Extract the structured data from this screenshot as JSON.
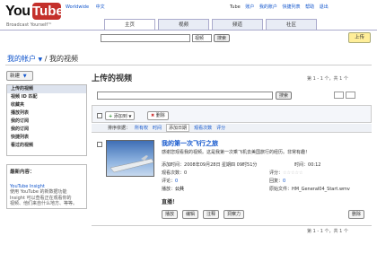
{
  "header": {
    "logo_you": "You",
    "logo_tube": "Tube",
    "tagline": "Broadcast Yourself™",
    "locale_links": [
      "Worldwide",
      "中文"
    ],
    "user_brand": "Tube",
    "user_links": [
      "账户",
      "我的账户",
      "快捷列表",
      "帮助",
      "退出"
    ],
    "tabs": [
      "主页",
      "视频",
      "频道",
      "社区"
    ],
    "search_type": "视频",
    "search_button": "搜索",
    "upload_button": "上传"
  },
  "breadcrumb": {
    "account": "我的帐户",
    "separator": "/",
    "current": "我的视频"
  },
  "sidebar": {
    "new_button": "新建",
    "items": [
      "上传的视频",
      "视频 ID 匹配",
      "收藏夹",
      "播放列表",
      "我的订阅",
      "我的订阅",
      "快捷列表",
      "看过的视频"
    ],
    "insight_title": "最新内容：",
    "insight_link": "YouTube Insight",
    "insight_desc": [
      "使用 YouTube 的新数据功能",
      "Insight 可以查看正在观看你的",
      "视频、他们来自什么地方、等等。"
    ]
  },
  "main": {
    "title": "上传的视频",
    "pager": "第 1 - 1 个，共 1 个",
    "search_button": "搜索",
    "toolbar": {
      "add_to": "添加到",
      "remove": "删除"
    },
    "sort": {
      "label": "排序依据：",
      "options": [
        "所有权",
        "时间",
        "添加日期",
        "观看次数",
        "评分"
      ],
      "selected": "添加日期"
    },
    "video": {
      "title": "我的第一次飞行之旅",
      "description": "感谢您观看我的视频。这是我第一次乘飞机去美国旅行的经历。非常有趣！",
      "added_label": "添加时间：",
      "added_value": "2008年09月28日 星期四 09时51分",
      "duration_label": "时间：",
      "duration_value": "00:12",
      "views_label": "观看次数：",
      "views_value": "0",
      "rating_label": "评分：",
      "comments_label": "评论：",
      "comments_value": "0",
      "responses_label": "回复：",
      "responses_value": "0",
      "broadcast_label": "播放：",
      "broadcast_value": "公共",
      "filename_label": "原始文件：",
      "filename_value": "HM_General04_Start.wmv",
      "status": "直播！",
      "actions": [
        "播放",
        "编辑",
        "注释",
        "洞察力"
      ],
      "delete": "删除"
    },
    "pager_bottom": "第 1 - 1 个，共 1 个"
  }
}
